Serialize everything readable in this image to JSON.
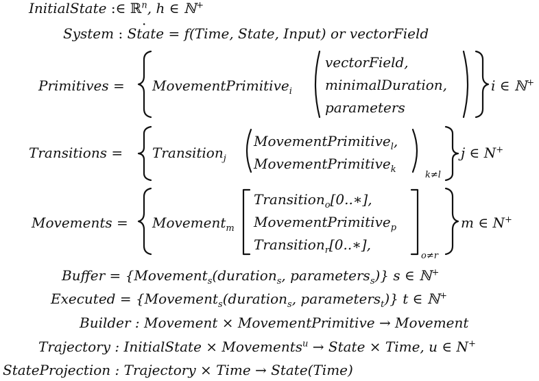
{
  "line1": {
    "lhs": "InitialState",
    "colon": " :",
    "rel": "∈ ℝ",
    "sup": "n",
    "rest": ", h ∈ ℕ",
    "sup2": "+"
  },
  "line2": {
    "lhs": "System",
    "colon": " : ",
    "state_dot": "State",
    "rest": " = f(Time, State, Input)  or vectorField"
  },
  "primitives": {
    "lhs": "Primitives =",
    "name": "MovementPrimitive",
    "sub": "i",
    "args": [
      "vectorField,",
      "minimalDuration,",
      "parameters"
    ],
    "tail": "i ∈ ℕ",
    "tail_sup": "+"
  },
  "transitions": {
    "lhs": "Transitions =",
    "name": "Transition",
    "sub": "j",
    "args": [
      "MovementPrimitive",
      "MovementPrimitive"
    ],
    "arg_subs": [
      "l",
      "k"
    ],
    "arg_tail": [
      ",",
      ""
    ],
    "cond": "k≠l",
    "tail": "j ∈ N",
    "tail_sup": "+"
  },
  "movements": {
    "lhs": "Movements =",
    "name": "Movement",
    "sub": "m",
    "args": [
      "Transition",
      "MovementPrimitive",
      "Transition"
    ],
    "arg_subs": [
      "o",
      "p",
      "r"
    ],
    "arg_tail": [
      "[0..∗],",
      "",
      "[0..∗],"
    ],
    "cond": "o≠r",
    "tail": "m ∈ N",
    "tail_sup": "+"
  },
  "buffer": {
    "lhs": "Buffer = {Movement",
    "s1": "s",
    "mid": "(duration",
    "s2": "s",
    "mid2": ", parameters",
    "s3": "s",
    "end": ")} s ∈ ℕ",
    "sup": "+"
  },
  "executed": {
    "lhs": "Executed = {Movement",
    "s1": "s",
    "mid": "(duration",
    "s2": "s",
    "mid2": ", parameters",
    "s3": "t",
    "end": ")} t ∈ ℕ",
    "sup": "+"
  },
  "builder": {
    "text": "Builder : Movement × MovementPrimitive → Movement"
  },
  "trajectory": {
    "lhs": "Trajectory : InitialState × Movements",
    "sup": "u",
    "rest": " → State × Time, u ∈ N",
    "sup2": "+"
  },
  "projection": {
    "text": "StateProjection : Trajectory × Time → State(Time)"
  }
}
